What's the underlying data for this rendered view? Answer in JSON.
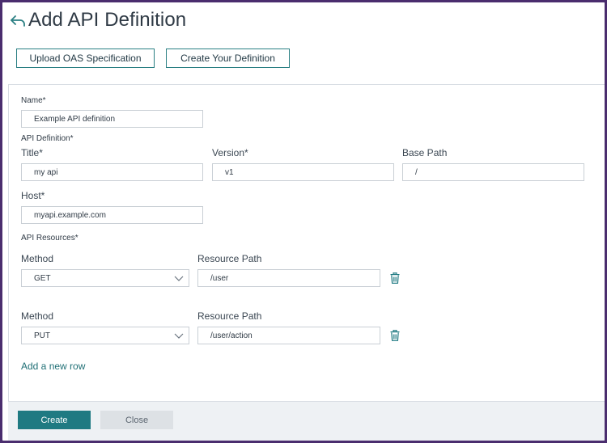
{
  "header": {
    "title": "Add API Definition",
    "upload_label": "Upload OAS Specification",
    "create_definition_label": "Create Your Definition"
  },
  "form": {
    "name_label": "Name*",
    "name_value": "Example API definition",
    "api_definition_label": "API Definition*",
    "title_label": "Title*",
    "title_value": "my api",
    "version_label": "Version*",
    "version_value": "v1",
    "base_path_label": "Base Path",
    "base_path_value": "/",
    "host_label": "Host*",
    "host_value": "myapi.example.com",
    "api_resources_label": "API Resources*",
    "resources": [
      {
        "method_label": "Method",
        "method_value": "GET",
        "path_label": "Resource Path",
        "path_value": "/user"
      },
      {
        "method_label": "Method",
        "method_value": "PUT",
        "path_label": "Resource Path",
        "path_value": "/user/action"
      }
    ],
    "add_row_label": "Add a new row"
  },
  "footer": {
    "create_label": "Create",
    "close_label": "Close"
  },
  "colors": {
    "accent": "#1f7a82",
    "frame": "#4a2d6e",
    "footer_bg": "#eef1f4"
  },
  "icons": [
    "back-arrow-icon",
    "chevron-down-icon",
    "trash-icon"
  ]
}
